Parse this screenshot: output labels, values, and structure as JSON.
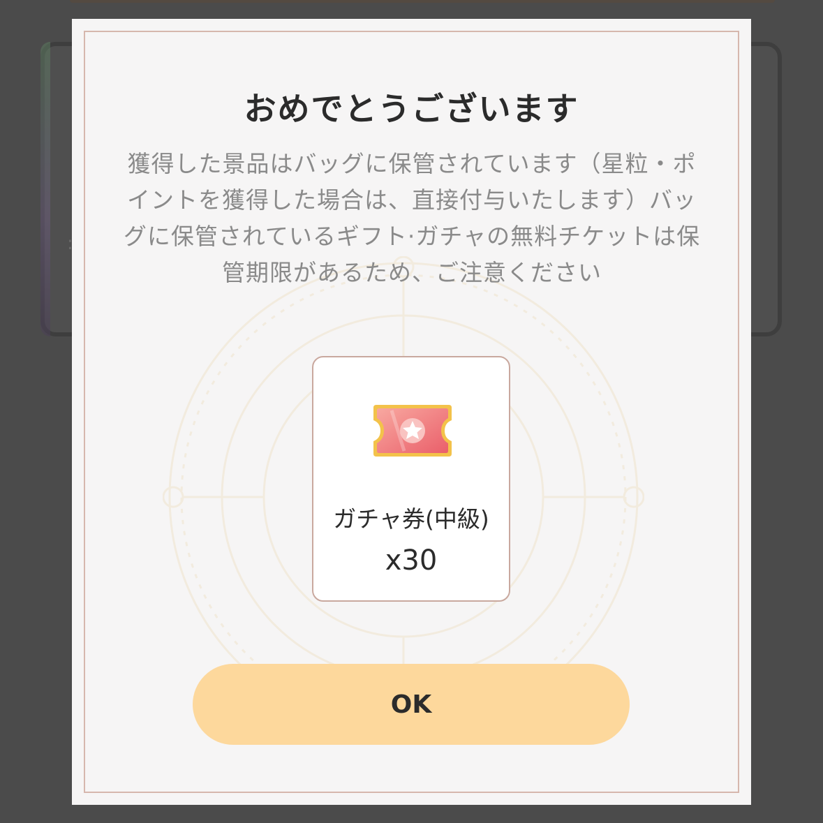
{
  "dialog": {
    "title": "おめでとうございます",
    "message": "獲得した景品はバッグに保管されています（星粒・ポイントを獲得した場合は、直接付与いたします）バッグに保管されているギフト·ガチャの無料チケットは保管期限があるため、ご注意ください",
    "ok_label": "OK"
  },
  "reward": {
    "icon": "gacha-ticket-icon",
    "name": "ガチャ券(中級)",
    "quantity": "x30"
  },
  "colors": {
    "overlay": "#4b4b4b",
    "modal_bg": "#f6f5f5",
    "frame_border": "#d6b7ad",
    "button_bg": "#fdd89c",
    "ticket_pink": "#f07a80",
    "ticket_gold": "#f3c24a"
  }
}
